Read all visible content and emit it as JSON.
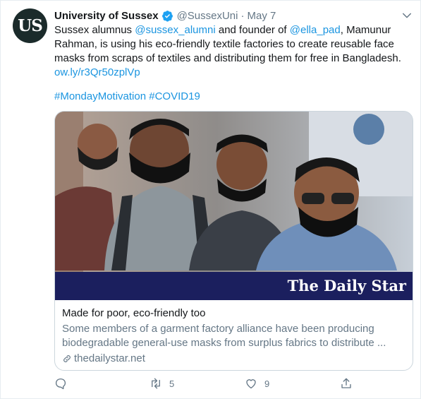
{
  "author": {
    "name": "University of Sussex",
    "handle": "@SussexUni",
    "separator": "·",
    "date": "May 7",
    "avatar_text": "US"
  },
  "tweet": {
    "text_1": "Sussex alumnus ",
    "mention_1": "@sussex_alumni",
    "text_2": " and founder of ",
    "mention_2": "@ella_pad",
    "text_3": ", Mamunur Rahman, is using his eco-friendly textile factories to create reusable face masks from scraps of textiles and distributing them for free in Bangladesh.",
    "url": "ow.ly/r3Qr50zplVp",
    "hashtag_1": "#MondayMotivation",
    "hashtag_2": "#COVID19"
  },
  "card": {
    "banner_text": "The Daily Star",
    "title": "Made for poor, eco-friendly too",
    "description": "Some members of a garment factory alliance have been producing biodegradable general-use masks from surplus fabrics to distribute ...",
    "domain": "thedailystar.net"
  },
  "actions": {
    "reply_count": "",
    "retweet_count": "5",
    "like_count": "9"
  },
  "icons": [
    "verified-badge-icon",
    "caret-down-icon",
    "link-icon",
    "reply-icon",
    "retweet-icon",
    "like-icon",
    "share-icon"
  ],
  "colors": {
    "link": "#1b95e0",
    "secondary_text": "#657786",
    "banner_navy": "#1b1f5e"
  }
}
